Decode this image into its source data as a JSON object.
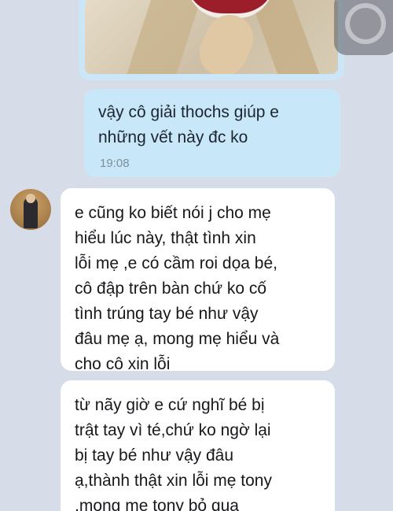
{
  "messages": {
    "outgoing_text": "vậy cô giải thochs giúp e\nnhững vết này đc ko",
    "outgoing_time": "19:08",
    "incoming_1": "e cũng ko biết nói j cho mẹ\nhiểu lúc này, thật tình xin\nlỗi mẹ ,e có cầm roi dọa bé,\ncô đập trên bàn chứ ko cố\ntình trúng tay bé như vậy\nđâu mẹ ạ, mong mẹ hiểu và\ncho cô xin lỗi",
    "incoming_2": "từ nãy giờ e cứ nghĩ bé bị\ntrật tay vì té,chứ ko ngờ lại\nbị tay bé như vậy đâu\nạ,thành thật xin lỗi mẹ tony\n,mong mẹ tony bỏ qua"
  },
  "colors": {
    "background": "#d7dde8",
    "outgoing_bubble": "#c8e7f8",
    "incoming_bubble": "#ffffff"
  },
  "icons": {
    "assistive_touch": "assistive-touch-icon"
  }
}
